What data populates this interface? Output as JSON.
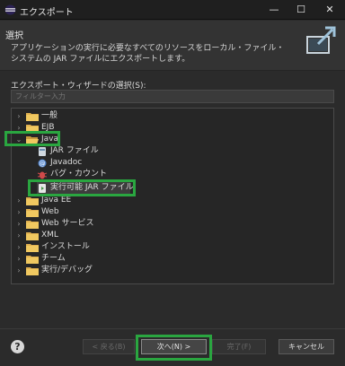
{
  "window": {
    "title": "エクスポート",
    "minimize": "—",
    "maximize": "☐",
    "close": "✕"
  },
  "header": {
    "title": "選択",
    "description": "アプリケーションの実行に必要なすべてのリソースをローカル・ファイル・システムの JAR ファイルにエクスポートします。"
  },
  "wizard": {
    "label": "エクスポート・ウィザードの選択(S):",
    "filter_placeholder": "フィルター入力"
  },
  "tree": {
    "general": "一般",
    "ejb": "EJB",
    "java": "Java",
    "java_children": {
      "jar": "JAR ファイル",
      "javadoc": "Javadoc",
      "bug_count": "バグ・カウント",
      "runnable_jar": "実行可能 JAR ファイル"
    },
    "javaee": "Java EE",
    "web": "Web",
    "web_service": "Web サービス",
    "xml": "XML",
    "install": "インストール",
    "team": "チーム",
    "run_debug": "実行/デバッグ"
  },
  "buttons": {
    "help": "?",
    "back": "< 戻る(B)",
    "next": "次へ(N) >",
    "finish": "完了(F)",
    "cancel": "キャンセル"
  },
  "colors": {
    "highlight": "#2aa640",
    "folder": "#e0b050",
    "background": "#2b2b2b"
  }
}
